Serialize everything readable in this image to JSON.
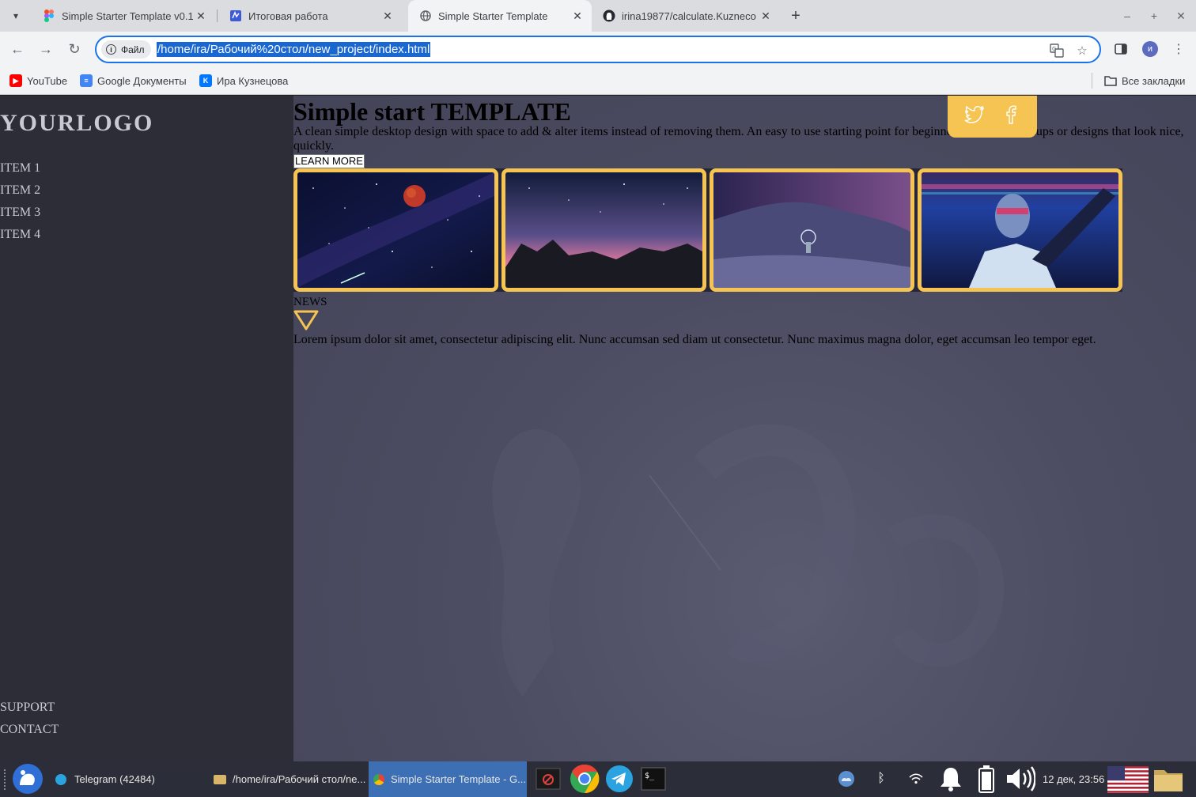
{
  "browser": {
    "tabs": [
      {
        "title": "Simple Starter Template v0.1 (",
        "icon": "figma-icon"
      },
      {
        "title": "Итоговая работа",
        "icon": "doc-icon"
      },
      {
        "title": "Simple Starter Template",
        "icon": "globe-icon",
        "active": true
      },
      {
        "title": "irina19877/calculate.Kuzneco",
        "icon": "github-icon"
      }
    ],
    "url_chip": "Файл",
    "url": "/home/ira/Рабочий%20стол/new_project/index.html",
    "avatar_letter": "и",
    "bookmarks": [
      {
        "label": "YouTube",
        "icon": "youtube-icon"
      },
      {
        "label": "Google Документы",
        "icon": "google-docs-icon"
      },
      {
        "label": "Ира Кузнецова",
        "icon": "vk-icon"
      }
    ],
    "all_bookmarks": "Все закладки"
  },
  "site": {
    "logo": "YOURLOGO",
    "nav": [
      "ITEM 1",
      "ITEM 2",
      "ITEM 3",
      "ITEM 4"
    ],
    "footer_nav": [
      "SUPPORT",
      "CONTACT"
    ],
    "heading": "Simple start TEMPLATE",
    "lead": "A clean simple desktop design with space to add & alter items instead of removing them. An easy to use starting point for beginners to make mockups or designs that look nice, quickly.",
    "learn_more": "LEARN MORE",
    "social": [
      "twitter-icon",
      "facebook-icon"
    ],
    "gallery": [
      "space-moon-image",
      "starry-rocks-image",
      "snow-night-image",
      "cyberpunk-figure-image"
    ],
    "news_label": "NEWS",
    "news_text": "Lorem ipsum dolor sit amet, consectetur adipiscing elit. Nunc accumsan sed diam ut consectetur. Nunc maximus magna dolor, eget accumsan leo tempor eget.",
    "accent_color": "#f5c453"
  },
  "taskbar": {
    "items": [
      {
        "label": "Telegram (42484)",
        "icon": "telegram-icon"
      },
      {
        "label": "/home/ira/Рабочий стол/ne...",
        "icon": "folder-icon"
      },
      {
        "label": "Simple Starter Template - G...",
        "icon": "chrome-icon",
        "active": true
      }
    ],
    "clock": "12 дек, 23:56"
  }
}
